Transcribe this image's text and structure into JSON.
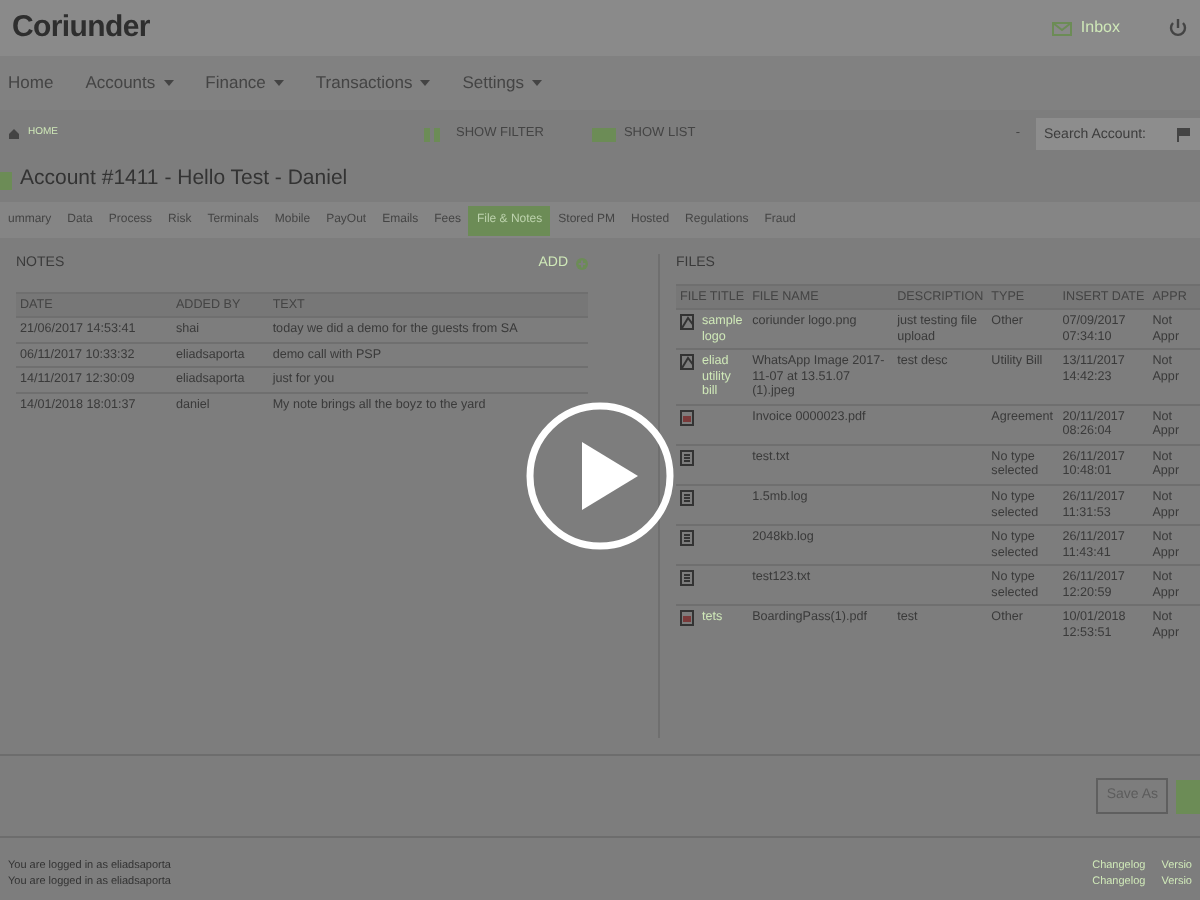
{
  "header": {
    "logo": "Coriunder",
    "inbox": "Inbox"
  },
  "menu": [
    {
      "label": "Home",
      "dropdown": false
    },
    {
      "label": "Accounts",
      "dropdown": true
    },
    {
      "label": "Finance",
      "dropdown": true
    },
    {
      "label": "Transactions",
      "dropdown": true
    },
    {
      "label": "Settings",
      "dropdown": true
    }
  ],
  "toolbar": {
    "breadcrumb": "HOME",
    "show_filter": "SHOW FILTER",
    "show_list": "SHOW LIST",
    "separator": "-",
    "search": {
      "placeholder": "Search Account:"
    }
  },
  "title": "Account #1411 - Hello Test - Daniel",
  "tabs": [
    {
      "label": "ummary",
      "selected": false
    },
    {
      "label": "Data",
      "selected": false
    },
    {
      "label": "Process",
      "selected": false
    },
    {
      "label": "Risk",
      "selected": false
    },
    {
      "label": "Terminals",
      "selected": false
    },
    {
      "label": "Mobile",
      "selected": false
    },
    {
      "label": "PayOut",
      "selected": false
    },
    {
      "label": "Emails",
      "selected": false
    },
    {
      "label": "Fees",
      "selected": false
    },
    {
      "label": "File & Notes",
      "selected": true
    },
    {
      "label": "Stored PM",
      "selected": false
    },
    {
      "label": "Hosted",
      "selected": false
    },
    {
      "label": "Regulations",
      "selected": false
    },
    {
      "label": "Fraud",
      "selected": false
    }
  ],
  "notes": {
    "title": "NOTES",
    "add": "ADD",
    "columns": [
      "DATE",
      "ADDED BY",
      "TEXT"
    ],
    "rows": [
      [
        "21/06/2017 14:53:41",
        "shai",
        "today we did a demo for the guests from SA"
      ],
      [
        "06/11/2017 10:33:32",
        "eliadsaporta",
        "demo call with PSP"
      ],
      [
        "14/11/2017 12:30:09",
        "eliadsaporta",
        "just for you"
      ],
      [
        "14/01/2018 18:01:37",
        "daniel",
        "My note brings all the boyz to the yard"
      ]
    ]
  },
  "files": {
    "title": "FILES",
    "columns": [
      "FILE TITLE",
      "FILE NAME",
      "DESCRIPTION",
      "TYPE",
      "INSERT DATE",
      "APPR"
    ],
    "rows": [
      {
        "kind": "image",
        "title": "sample logo",
        "name": "coriunder logo.png",
        "description": "just testing file upload",
        "type": "Other",
        "date": "07/09/2017 07:34:10",
        "status": "Not Appr"
      },
      {
        "kind": "image",
        "title": "eliad utility bill",
        "name": "WhatsApp Image 2017-11-07 at 13.51.07 (1).jpeg",
        "description": "test desc",
        "type": "Utility Bill",
        "date": "13/11/2017 14:42:23",
        "status": "Not Appr"
      },
      {
        "kind": "pdf",
        "title": "",
        "name": "Invoice 0000023.pdf",
        "description": "",
        "type": "Agreement",
        "date": "20/11/2017 08:26:04",
        "status": "Not Appr"
      },
      {
        "kind": "text",
        "name": "test.txt",
        "type": "No type selected",
        "date": "26/11/2017 10:48:01",
        "status": "Not Appr"
      },
      {
        "kind": "text",
        "name": "1.5mb.log",
        "type": "No type selected",
        "date": "26/11/2017 11:31:53",
        "status": "Not Appr"
      },
      {
        "kind": "text",
        "name": "2048kb.log",
        "type": "No type selected",
        "date": "26/11/2017 11:43:41",
        "status": "Not Appr"
      },
      {
        "kind": "text",
        "name": "test123.txt",
        "type": "No type selected",
        "date": "26/11/2017 12:20:59",
        "status": "Not Appr"
      },
      {
        "kind": "pdf",
        "title": "tets",
        "name": "BoardingPass(1).pdf",
        "description": "test",
        "type": "Other",
        "date": "10/01/2018 12:53:51",
        "status": "Not Appr"
      }
    ]
  },
  "save_as": "Save As",
  "footer": [
    {
      "text": "You are logged in as eliadsaporta",
      "changelog": "Changelog",
      "version": "Versio"
    },
    {
      "text": "You are logged in as eliadsaporta",
      "changelog": "Changelog",
      "version": "Versio"
    }
  ]
}
